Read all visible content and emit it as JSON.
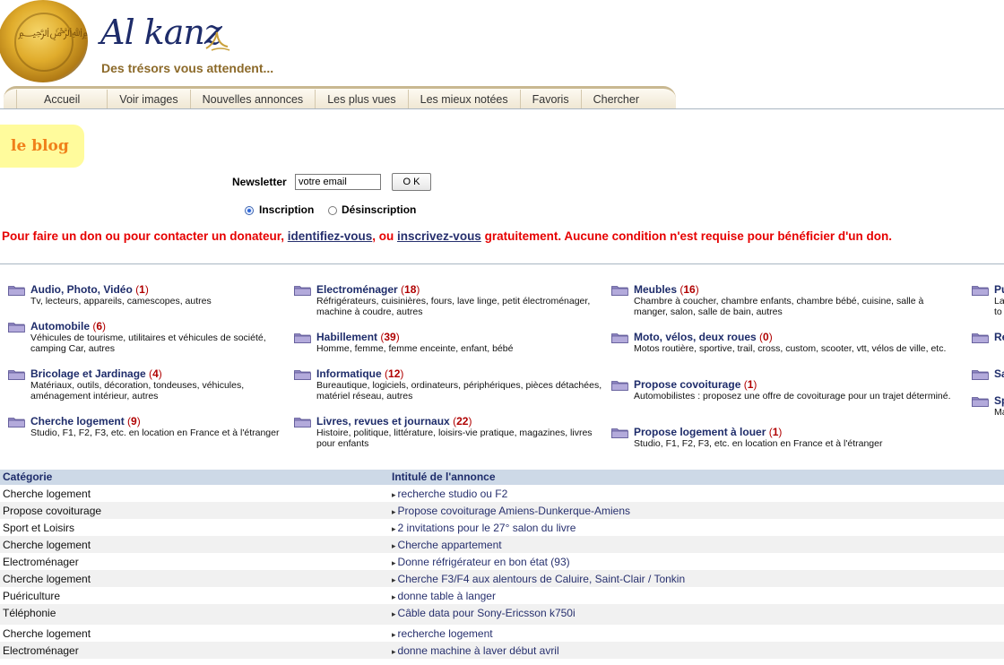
{
  "header": {
    "brand": "Al kanz",
    "tagline": "Des trésors vous attendent..."
  },
  "nav": {
    "tabs": [
      "Accueil",
      "Voir images",
      "Nouvelles annonces",
      "Les plus vues",
      "Les mieux notées",
      "Favoris",
      "Chercher"
    ]
  },
  "blog": {
    "label": "le blog"
  },
  "newsletter": {
    "label": "Newsletter",
    "input_value": "votre email",
    "ok_label": "O K",
    "option_subscribe": "Inscription",
    "option_unsubscribe": "Désinscription",
    "selected": "Inscription"
  },
  "notice": {
    "part1": "Pour faire un don ou pour contacter un donateur, ",
    "link1": "identifiez-vous",
    "part2": ", ou ",
    "link2": "inscrivez-vous",
    "part3": " gratuitement. Aucune condition n'est requise pour bénéficier d'un don."
  },
  "categories": {
    "col1": [
      {
        "name": "Audio, Photo, Vidéo",
        "count": "1",
        "desc": "Tv, lecteurs, appareils, camescopes, autres"
      },
      {
        "name": "Automobile",
        "count": "6",
        "desc": "Véhicules de tourisme, utilitaires et véhicules de société, camping Car, autres"
      },
      {
        "name": "Bricolage et Jardinage",
        "count": "4",
        "desc": "Matériaux, outils, décoration, tondeuses, véhicules, aménagement intérieur, autres"
      },
      {
        "name": "Cherche logement",
        "count": "9",
        "desc": "Studio, F1, F2, F3, etc. en location en France et à l'étranger"
      }
    ],
    "col2": [
      {
        "name": "Electroménager",
        "count": "18",
        "desc": "Réfrigérateurs, cuisinières, fours, lave linge, petit électroménager, machine à coudre, autres"
      },
      {
        "name": "Habillement",
        "count": "39",
        "desc": "Homme, femme, femme enceinte, enfant, bébé"
      },
      {
        "name": "Informatique",
        "count": "12",
        "desc": "Bureautique, logiciels, ordinateurs, périphériques, pièces détachées, matériel réseau, autres"
      },
      {
        "name": "Livres, revues et journaux",
        "count": "22",
        "desc": "Histoire, politique, littérature, loisirs-vie pratique, magazines, livres pour enfants"
      }
    ],
    "col3": [
      {
        "name": "Meubles",
        "count": "16",
        "desc": "Chambre à coucher, chambre enfants, chambre bébé, cuisine, salle à manger, salon, salle de bain, autres"
      },
      {
        "name": "Moto, vélos, deux roues",
        "count": "0",
        "desc": "Motos routière, sportive, trail, cross, custom, scooter, vtt, vélos de ville, etc."
      },
      {
        "name": "Propose covoiturage",
        "count": "1",
        "desc": "Automobilistes : proposez une offre de covoiturage pour un trajet déterminé."
      },
      {
        "name": "Propose logement à louer",
        "count": "1",
        "desc": "Studio, F1, F2, F3, etc. en location en France et à l'étranger"
      }
    ],
    "col4_partial": [
      {
        "name": "Pu",
        "desc": "La to"
      },
      {
        "name": "Re",
        "desc": ""
      },
      {
        "name": "Sa",
        "desc": ""
      },
      {
        "name": "Sp",
        "desc": "Ma"
      }
    ]
  },
  "listings": {
    "header_category": "Catégorie",
    "header_title": "Intitulé de l'annonce",
    "rows": [
      {
        "category": "Cherche logement",
        "title": "recherche studio ou F2"
      },
      {
        "category": "Propose covoiturage",
        "title": "Propose covoiturage Amiens-Dunkerque-Amiens"
      },
      {
        "category": "Sport et Loisirs",
        "title": "2 invitations pour le 27° salon du livre"
      },
      {
        "category": "Cherche logement",
        "title": "Cherche appartement"
      },
      {
        "category": "Electroménager",
        "title": "Donne réfrigérateur en bon état (93)"
      },
      {
        "category": "Cherche logement",
        "title": "Cherche F3/F4 aux alentours de Caluire, Saint-Clair / Tonkin"
      },
      {
        "category": "Puériculture",
        "title": "donne table à langer"
      },
      {
        "category": "Téléphonie",
        "title": "Câble data pour Sony-Ericsson k750i"
      },
      {
        "category": "Cherche logement",
        "title": "recherche logement"
      },
      {
        "category": "Electroménager",
        "title": "donne machine à laver début avril"
      }
    ]
  },
  "colors": {
    "brand_navy": "#1e2c6a",
    "notice_red": "#e60000",
    "count_red": "#b00000",
    "blog_bg": "#fffb9c",
    "blog_text": "#f0801a",
    "table_header_bg": "#cdd9e7"
  }
}
